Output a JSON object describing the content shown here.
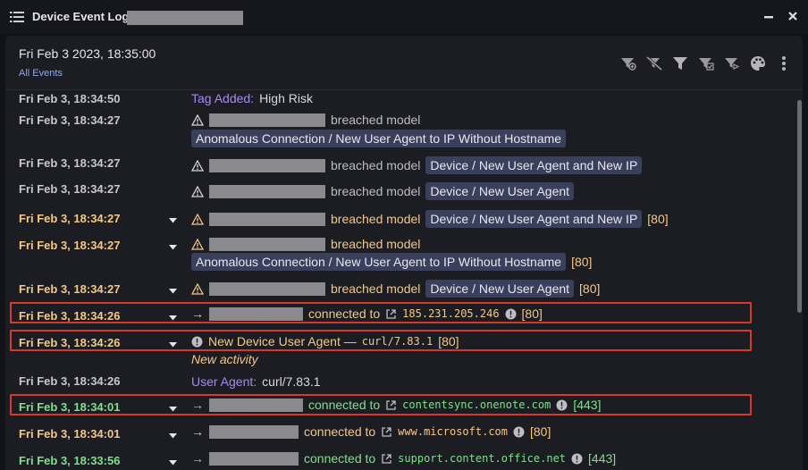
{
  "window": {
    "title": "Device Event Log",
    "menu_icon": "list-icon",
    "minimize_icon": "minimize-icon",
    "close_icon": "close-icon"
  },
  "header": {
    "date": "Fri Feb 3 2023, 18:35:00",
    "filter_link": "All Events",
    "toolbar_icons": [
      "add-filter-icon",
      "clear-filter-icon",
      "filter-icon",
      "filter-options-icon",
      "filter-toggle-icon",
      "palette-icon",
      "more-vertical-icon"
    ]
  },
  "colors": {
    "accent_purple": "#a889f2",
    "warning_orange": "#f5c787",
    "connection_green": "#7ee08a",
    "pill_bg": "#3a3f5c",
    "highlight_red": "#d63a2a"
  },
  "events": [
    {
      "time": "Fri Feb 3, 18:34:50",
      "tag_label": "Tag Added:",
      "tag_value": "High Risk"
    },
    {
      "time": "Fri Feb 3, 18:34:27",
      "text": "breached model",
      "model": "Anomalous Connection / New User Agent to IP Without Hostname"
    },
    {
      "time": "Fri Feb 3, 18:34:27",
      "text": "breached model",
      "model": "Device / New User Agent and New IP"
    },
    {
      "time": "Fri Feb 3, 18:34:27",
      "text": "breached model",
      "model": "Device / New User Agent"
    },
    {
      "time": "Fri Feb 3, 18:34:27",
      "text": "breached model",
      "model": "Device / New User Agent and New IP",
      "port": "[80]"
    },
    {
      "time": "Fri Feb 3, 18:34:27",
      "text": "breached model",
      "model": "Anomalous Connection / New User Agent to IP Without Hostname",
      "port": "[80]"
    },
    {
      "time": "Fri Feb 3, 18:34:27",
      "text": "breached model",
      "model": "Device / New User Agent",
      "port": "[80]"
    },
    {
      "time": "Fri Feb 3, 18:34:26",
      "text": "connected to",
      "dest": "185.231.205.246",
      "port": "[80]"
    },
    {
      "time": "Fri Feb 3, 18:34:26",
      "text": "New Device User Agent —",
      "agent": "curl/7.83.1",
      "port": "[80]",
      "note": "New activity"
    },
    {
      "time": "Fri Feb 3, 18:34:26",
      "ua_label": "User Agent:",
      "ua_value": "curl/7.83.1"
    },
    {
      "time": "Fri Feb 3, 18:34:01",
      "text": "connected to",
      "dest": "contentsync.onenote.com",
      "port": "[443]"
    },
    {
      "time": "Fri Feb 3, 18:34:01",
      "text": "connected to",
      "dest": "www.microsoft.com",
      "port": "[80]"
    },
    {
      "time": "Fri Feb 3, 18:33:56",
      "text": "connected to",
      "dest": "support.content.office.net",
      "port": "[443]"
    }
  ]
}
